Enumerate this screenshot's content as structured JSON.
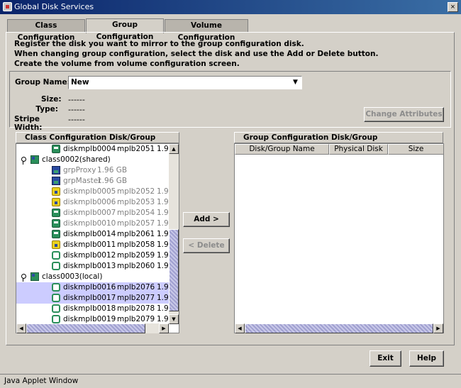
{
  "window": {
    "title": "Global Disk Services",
    "close_glyph": "×"
  },
  "tabs": [
    {
      "label": "Class Configuration",
      "active": false
    },
    {
      "label": "Group Configuration",
      "active": true
    },
    {
      "label": "Volume Configuration",
      "active": false
    }
  ],
  "instructions": [
    "Register the disk you want to mirror to the group configuration disk.",
    "When changing group configuration, select the disk and use the Add or Delete button.",
    "Create the volume from volume configuration screen."
  ],
  "group": {
    "name_label": "Group Name:",
    "name_value": "New",
    "size_label": "Size:",
    "size_value": "------",
    "type_label": "Type:",
    "type_value": "------",
    "stripe_label": "Stripe Width:",
    "stripe_value": "------",
    "change_attributes": "Change Attributes"
  },
  "left_panel": {
    "title": "Class Configuration Disk/Group",
    "rows": [
      {
        "icon": "disk-icon",
        "name": "diskmplb0004",
        "dev": "mplb2051",
        "size": "1.9",
        "grey": false,
        "selected": false
      },
      {
        "icon": "class-icon",
        "name": "class0002(shared)",
        "dev": "",
        "size": "",
        "grey": false,
        "selected": false
      },
      {
        "icon": "group-icon",
        "name": "grpProxy",
        "dev": "1.96 GB",
        "size": "",
        "grey": true,
        "selected": false
      },
      {
        "icon": "group-icon",
        "name": "grpMaster",
        "dev": "1.96 GB",
        "size": "",
        "grey": true,
        "selected": false
      },
      {
        "icon": "warning-disk-icon",
        "name": "diskmplb0005",
        "dev": "mplb2052",
        "size": "1.9",
        "grey": true,
        "selected": false
      },
      {
        "icon": "warning-disk-icon",
        "name": "diskmplb0006",
        "dev": "mplb2053",
        "size": "1.9",
        "grey": true,
        "selected": false
      },
      {
        "icon": "disk-icon",
        "name": "diskmplb0007",
        "dev": "mplb2054",
        "size": "1.9",
        "grey": true,
        "selected": false
      },
      {
        "icon": "disk-icon",
        "name": "diskmplb0010",
        "dev": "mplb2057",
        "size": "1.9",
        "grey": true,
        "selected": false
      },
      {
        "icon": "disk-icon",
        "name": "diskmplb0014",
        "dev": "mplb2061",
        "size": "1.9",
        "grey": false,
        "selected": false
      },
      {
        "icon": "warning-disk-icon",
        "name": "diskmplb0011",
        "dev": "mplb2058",
        "size": "1.9",
        "grey": false,
        "selected": false
      },
      {
        "icon": "ring-disk-icon",
        "name": "diskmplb0012",
        "dev": "mplb2059",
        "size": "1.9",
        "grey": false,
        "selected": false
      },
      {
        "icon": "ring-disk-icon",
        "name": "diskmplb0013",
        "dev": "mplb2060",
        "size": "1.9",
        "grey": false,
        "selected": false
      },
      {
        "icon": "class-icon",
        "name": "class0003(local)",
        "dev": "",
        "size": "",
        "grey": false,
        "selected": false
      },
      {
        "icon": "ring-disk-icon",
        "name": "diskmplb0016",
        "dev": "mplb2076",
        "size": "1.9",
        "grey": false,
        "selected": true
      },
      {
        "icon": "ring-disk-icon",
        "name": "diskmplb0017",
        "dev": "mplb2077",
        "size": "1.9",
        "grey": false,
        "selected": true
      },
      {
        "icon": "ring-disk-icon",
        "name": "diskmplb0018",
        "dev": "mplb2078",
        "size": "1.9",
        "grey": false,
        "selected": false
      },
      {
        "icon": "ring-disk-icon",
        "name": "diskmplb0019",
        "dev": "mplb2079",
        "size": "1.9",
        "grey": false,
        "selected": false
      }
    ]
  },
  "buttons": {
    "add": "Add >",
    "delete": "< Delete",
    "exit": "Exit",
    "help": "Help"
  },
  "right_panel": {
    "title": "Group Configuration Disk/Group",
    "columns": [
      "Disk/Group Name",
      "Physical Disk",
      "Size"
    ]
  },
  "scroll_glyphs": {
    "up": "▲",
    "down": "▼",
    "left": "◀",
    "right": "▶",
    "combo": "▼"
  },
  "status": "Java Applet Window"
}
